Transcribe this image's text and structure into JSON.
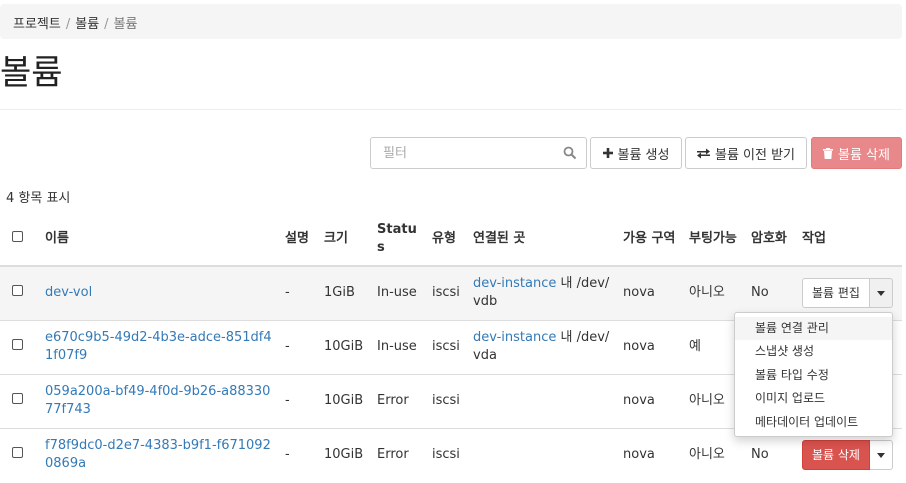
{
  "breadcrumb": {
    "project": "프로젝트",
    "sep1": "/",
    "volumes": "볼륨",
    "sep2": "/",
    "current": "볼륨"
  },
  "page_title": "볼륨",
  "toolbar": {
    "filter_placeholder": "필터",
    "create_label": "볼륨 생성",
    "transfer_label": "볼륨 이전 받기",
    "delete_label": "볼륨 삭제",
    "delete_color": "#e8888a"
  },
  "summary": "4 항목 표시",
  "table": {
    "headers": {
      "name": "이름",
      "description": "설명",
      "size": "크기",
      "status": "Status",
      "type": "유형",
      "attached": "연결된 곳",
      "zone": "가용 구역",
      "bootable": "부팅가능",
      "encrypted": "암호화",
      "actions": "작업"
    },
    "rows": [
      {
        "name": "dev-vol",
        "description": "-",
        "size": "1GiB",
        "status": "In-use",
        "type": "iscsi",
        "attached_link": "dev-instance",
        "attached_suffix": " 내 /dev/vdb",
        "zone": "nova",
        "bootable": "아니오",
        "encrypted": "No",
        "action": "볼륨 편집"
      },
      {
        "name": "e670c9b5-49d2-4b3e-adce-851df41f07f9",
        "description": "-",
        "size": "10GiB",
        "status": "In-use",
        "type": "iscsi",
        "attached_link": "dev-instance",
        "attached_suffix": " 내 /dev/vda",
        "zone": "nova",
        "bootable": "예",
        "encrypted": "",
        "action": ""
      },
      {
        "name": "059a200a-bf49-4f0d-9b26-a8833077f743",
        "description": "-",
        "size": "10GiB",
        "status": "Error",
        "type": "iscsi",
        "attached_link": "",
        "attached_suffix": "",
        "zone": "nova",
        "bootable": "아니오",
        "encrypted": "",
        "action": ""
      },
      {
        "name": "f78f9dc0-d2e7-4383-b9f1-f6710920869a",
        "description": "-",
        "size": "10GiB",
        "status": "Error",
        "type": "iscsi",
        "attached_link": "",
        "attached_suffix": "",
        "zone": "nova",
        "bootable": "아니오",
        "encrypted": "No",
        "action": "볼륨 삭제"
      }
    ]
  },
  "dropdown": {
    "items": [
      "볼륨 연결 관리",
      "스냅샷 생성",
      "볼륨 타입 수정",
      "이미지 업로드",
      "메타데이터 업데이트"
    ]
  },
  "icons": [
    "search-icon",
    "plus-icon",
    "exchange-icon",
    "trash-icon",
    "caret-down-icon"
  ],
  "colors": {
    "link": "#337ab7",
    "danger": "#d9534f"
  }
}
